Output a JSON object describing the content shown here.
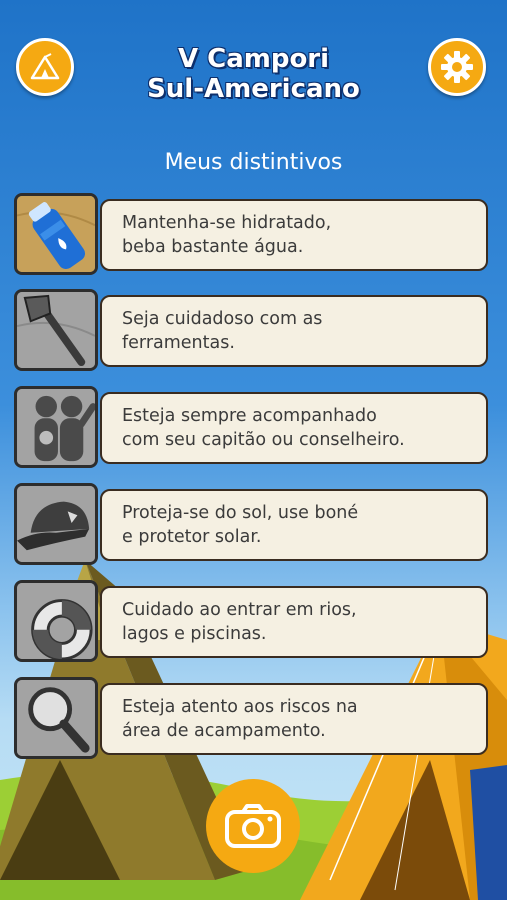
{
  "header": {
    "title_line1": "V Campori",
    "title_line2": "Sul-Americano",
    "left_icon": "tent-icon",
    "right_icon": "gear-icon"
  },
  "page": {
    "subtitle": "Meus distintivos"
  },
  "badges": [
    {
      "text": "Mantenha-se hidratado,\nbeba bastante água.",
      "icon": "water-bottle-icon",
      "unlocked": true
    },
    {
      "text": "Seja cuidadoso com as\nferramentas.",
      "icon": "axe-icon",
      "unlocked": false
    },
    {
      "text": "Esteja sempre acompanhado\ncom seu capitão ou conselheiro.",
      "icon": "people-icon",
      "unlocked": false
    },
    {
      "text": "Proteja-se do sol, use boné\ne protetor solar.",
      "icon": "cap-icon",
      "unlocked": false
    },
    {
      "text": "Cuidado ao entrar em rios,\nlagos e piscinas.",
      "icon": "lifebuoy-icon",
      "unlocked": false
    },
    {
      "text": "Esteja atento aos riscos na\nárea de acampamento.",
      "icon": "magnifier-icon",
      "unlocked": false
    }
  ],
  "footer": {
    "camera_icon": "camera-icon"
  },
  "colors": {
    "accent": "#f5a912",
    "sky_top": "#1f73c8",
    "card": "#f5f0e2"
  }
}
